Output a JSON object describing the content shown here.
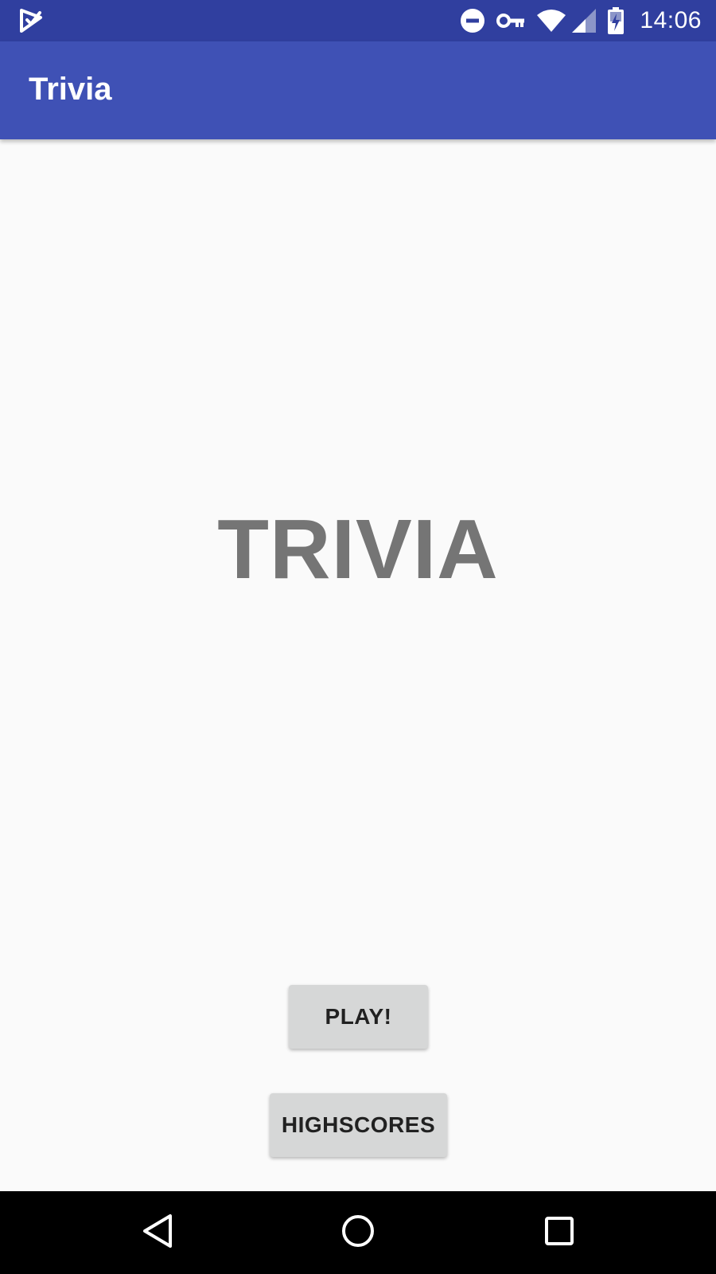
{
  "status_bar": {
    "time": "14:06",
    "icons": [
      "app-notification-icon",
      "do-not-disturb-icon",
      "vpn-key-icon",
      "wifi-icon",
      "cell-signal-icon",
      "battery-charging-icon"
    ]
  },
  "app_bar": {
    "title": "Trivia"
  },
  "main": {
    "title": "TRIVIA",
    "play_label": "PLAY!",
    "highscores_label": "HIGHSCORES"
  },
  "nav_bar": {
    "icons": [
      "back-icon",
      "home-icon",
      "recents-icon"
    ]
  },
  "colors": {
    "status_bar": "#303f9f",
    "app_bar": "#3f51b5",
    "background": "#fafafa",
    "title_text": "#757575",
    "button_bg": "#d6d7d7",
    "nav_bar": "#000000"
  }
}
